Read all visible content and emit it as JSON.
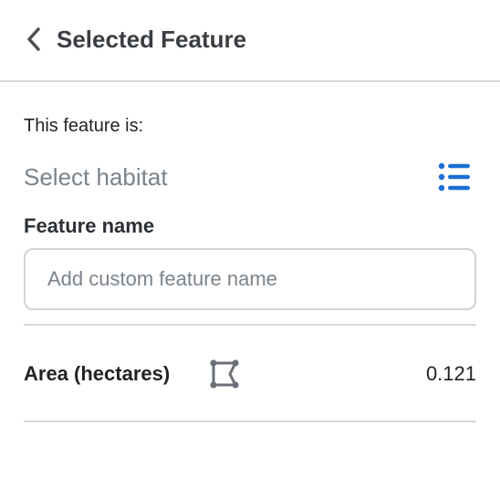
{
  "header": {
    "title": "Selected Feature",
    "back_icon": "chevron-left-icon"
  },
  "habitat": {
    "intro_label": "This feature is:",
    "select_text": "Select habitat",
    "list_icon": "list-icon",
    "accent_color": "#1a6fd4"
  },
  "feature_name": {
    "label": "Feature name",
    "value": "",
    "placeholder": "Add custom feature name"
  },
  "area": {
    "label": "Area (hectares)",
    "icon": "polygon-area-icon",
    "value": "0.121"
  }
}
